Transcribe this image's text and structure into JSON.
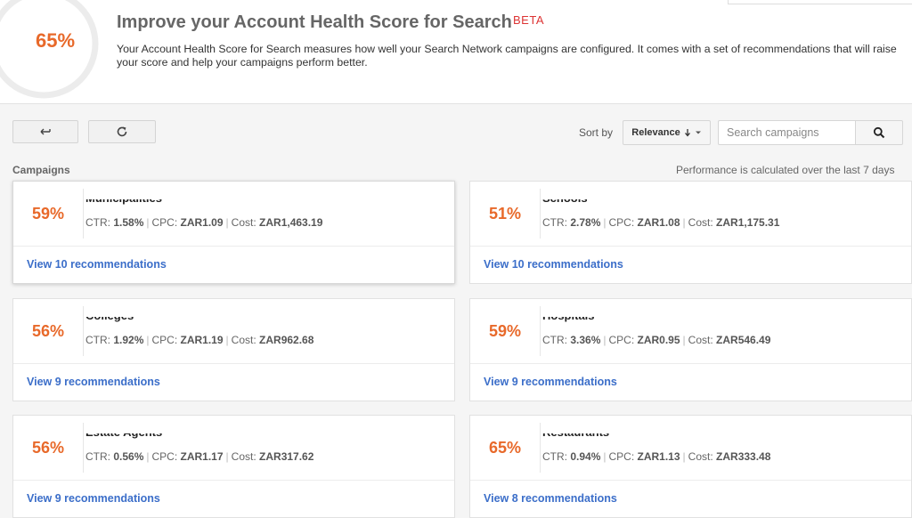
{
  "header": {
    "score": "65%",
    "title": "Improve your Account Health Score for Search",
    "beta": "BETA",
    "description": "Your Account Health Score for Search measures how well your Search Network campaigns are configured. It comes with a set of recommendations that will raise your score and help your campaigns perform better."
  },
  "toolbar": {
    "back_icon": "back-arrow-icon",
    "refresh_icon": "refresh-icon",
    "sort_label": "Sort by",
    "sort_value": "Relevance",
    "search_placeholder": "Search campaigns",
    "search_icon": "search-icon"
  },
  "list": {
    "label": "Campaigns",
    "note": "Performance is calculated over the last 7 days"
  },
  "labels": {
    "ctr": "CTR:",
    "cpc": "CPC:",
    "cost": "Cost:",
    "sep": "|"
  },
  "colors": {
    "score": "#e8692a",
    "link": "#3b6ec9",
    "beta": "#dd3434"
  },
  "campaigns": [
    {
      "score": "59%",
      "name": "Municipalities",
      "ctr": "1.58%",
      "cpc": "ZAR1.09",
      "cost": "ZAR1,463.19",
      "link": "View 10 recommendations"
    },
    {
      "score": "51%",
      "name": "Schools",
      "ctr": "2.78%",
      "cpc": "ZAR1.08",
      "cost": "ZAR1,175.31",
      "link": "View 10 recommendations"
    },
    {
      "score": "56%",
      "name": "Colleges",
      "ctr": "1.92%",
      "cpc": "ZAR1.19",
      "cost": "ZAR962.68",
      "link": "View 9 recommendations"
    },
    {
      "score": "59%",
      "name": "Hospitals",
      "ctr": "3.36%",
      "cpc": "ZAR0.95",
      "cost": "ZAR546.49",
      "link": "View 9 recommendations"
    },
    {
      "score": "56%",
      "name": "Estate Agents",
      "ctr": "0.56%",
      "cpc": "ZAR1.17",
      "cost": "ZAR317.62",
      "link": "View 9 recommendations"
    },
    {
      "score": "65%",
      "name": "Restaurants",
      "ctr": "0.94%",
      "cpc": "ZAR1.13",
      "cost": "ZAR333.48",
      "link": "View 8 recommendations"
    }
  ]
}
